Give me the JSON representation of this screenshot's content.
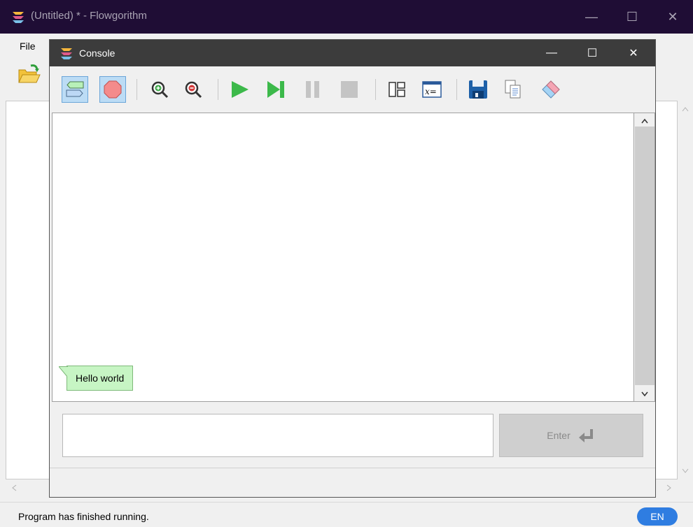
{
  "main_window": {
    "title": "(Untitled) * - Flowgorithm",
    "controls": {
      "minimize": "—",
      "maximize": "☐",
      "close": "✕"
    }
  },
  "menu": {
    "file_label": "File"
  },
  "console": {
    "title": "Console",
    "controls": {
      "minimize": "—",
      "maximize": "☐",
      "close": "✕"
    },
    "toolbar": [
      {
        "icon": "chat-view-icon",
        "active": true
      },
      {
        "icon": "stop-sign-icon",
        "active": true
      },
      {
        "icon": "zoom-in-icon"
      },
      {
        "icon": "zoom-out-icon"
      },
      {
        "icon": "run-icon"
      },
      {
        "icon": "step-icon"
      },
      {
        "icon": "pause-icon"
      },
      {
        "icon": "stop-icon"
      },
      {
        "icon": "layout-icon"
      },
      {
        "icon": "variable-watch-icon"
      },
      {
        "icon": "save-icon"
      },
      {
        "icon": "copy-icon"
      },
      {
        "icon": "eraser-icon"
      }
    ],
    "output": {
      "messages": [
        "Hello world"
      ]
    },
    "input": {
      "value": ""
    },
    "enter_label": "Enter"
  },
  "status": {
    "text": "Program has finished running.",
    "language": "EN"
  },
  "colors": {
    "titlebar": "#1f0d35",
    "console_titlebar": "#3c3c3c",
    "output_bubble": "#c7f5c4",
    "lang_badge": "#2f7de1"
  }
}
